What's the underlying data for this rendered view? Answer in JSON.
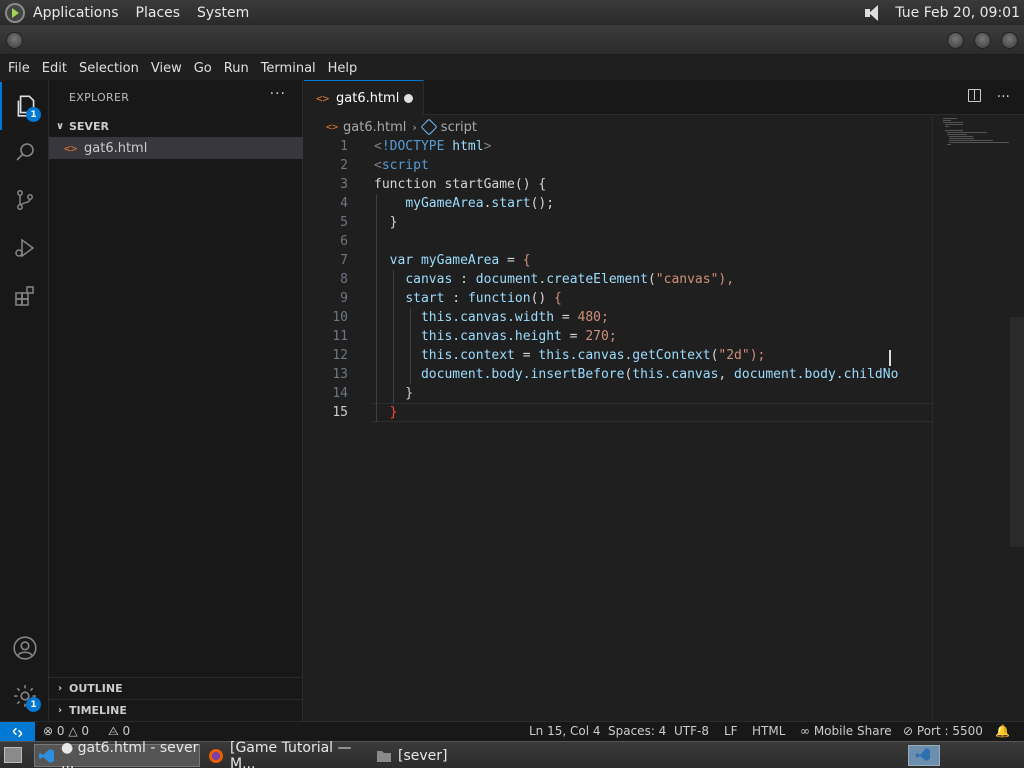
{
  "top_panel": {
    "menus": [
      "Applications",
      "Places",
      "System"
    ],
    "clock": "Tue Feb 20, 09:01"
  },
  "menubar": [
    "File",
    "Edit",
    "Selection",
    "View",
    "Go",
    "Run",
    "Terminal",
    "Help"
  ],
  "activity_bar": {
    "explorer_badge": "1",
    "settings_badge": "1"
  },
  "sidebar": {
    "title": "EXPLORER",
    "more": "···",
    "folder": "SEVER",
    "files": [
      "gat6.html"
    ],
    "outline": "OUTLINE",
    "timeline": "TIMELINE"
  },
  "editor": {
    "tab_label": "gat6.html",
    "breadcrumb": [
      "gat6.html",
      "script"
    ],
    "current_line": 15
  },
  "code_lines": [
    "<!DOCTYPE html>",
    "<script",
    "function startGame() {",
    "    myGameArea.start();",
    "  }",
    "",
    "  var myGameArea = {",
    "    canvas : document.createElement(\"canvas\"),",
    "    start : function() {",
    "      this.canvas.width = 480;",
    "      this.canvas.height = 270;",
    "      this.context = this.canvas.getContext(\"2d\");",
    "      document.body.insertBefore(this.canvas, document.body.childNo",
    "    }",
    "  }"
  ],
  "status_bar": {
    "remote_icon": "remote-icon",
    "errors": "0",
    "warnings": "0",
    "ports": "0",
    "position": "Ln 15, Col 4",
    "spaces": "Spaces: 4",
    "encoding": "UTF-8",
    "eol": "LF",
    "language": "HTML",
    "mobile_share": "Mobile Share",
    "port": "Port : 5500"
  },
  "taskbar": {
    "items": [
      "● gat6.html - sever ...",
      "[Game Tutorial — M...",
      "[sever]"
    ]
  },
  "colors": {
    "accent": "#0078d4",
    "keyword": "#569cd6",
    "string": "#ce9178",
    "number": "#b5cea8",
    "function": "#dcdcaa",
    "variable": "#9cdcfe",
    "html_icon": "#e37933"
  }
}
